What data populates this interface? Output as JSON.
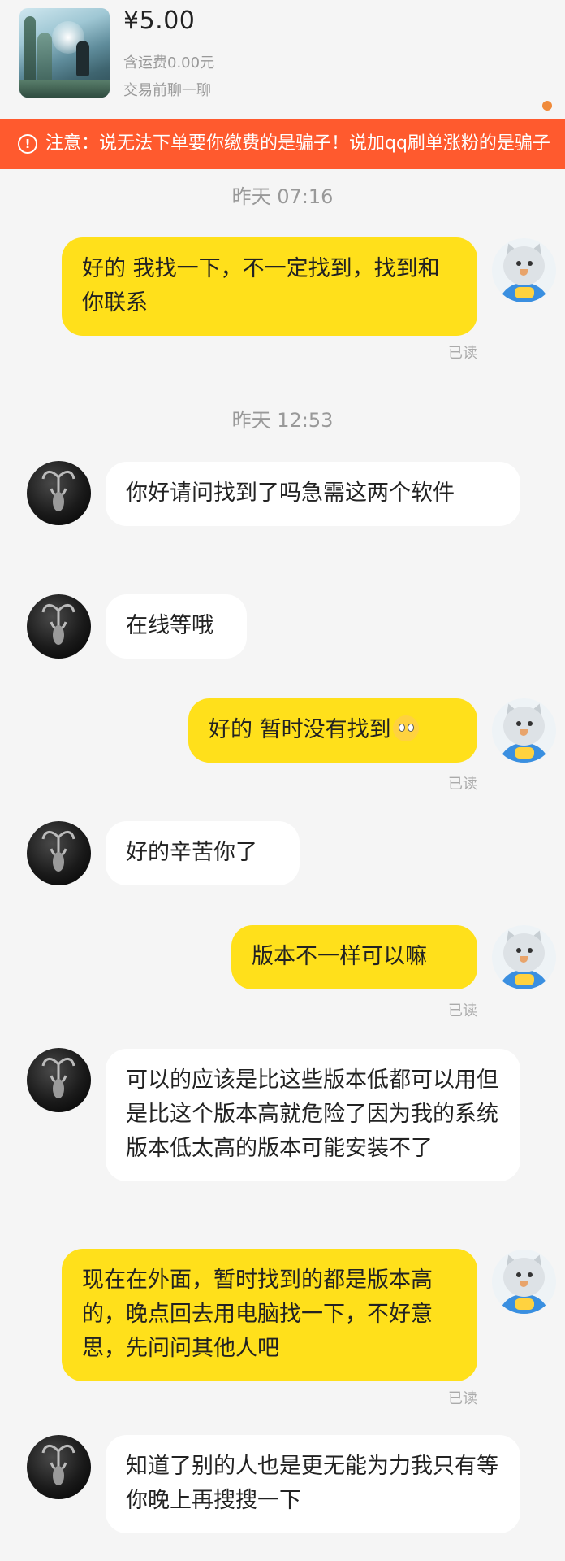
{
  "product": {
    "price": "¥5.00",
    "shipping": "含运费0.00元",
    "chat_before": "交易前聊一聊"
  },
  "banner": {
    "icon": "!",
    "text": "注意：说无法下单要你缴费的是骗子！说加qq刷单涨粉的是骗子"
  },
  "messages": {
    "ts1": "昨天 07:16",
    "m1": "好的 我找一下，不一定找到，找到和你联系",
    "read1": "已读",
    "ts2": "昨天 12:53",
    "m2": "你好请问找到了吗急需这两个软件",
    "m3": "在线等哦",
    "m4": "好的 暂时没有找到",
    "read4": "已读",
    "m5": "好的辛苦你了",
    "m6": "版本不一样可以嘛",
    "read6": "已读",
    "m7": "可以的应该是比这些版本低都可以用但是比这个版本高就危险了因为我的系统版本低太高的版本可能安装不了",
    "m8": "现在在外面，暂时找到的都是版本高的，晚点回去用电脑找一下，不好意思，先问问其他人吧",
    "read8": "已读",
    "m9": "知道了别的人也是更无能为力我只有等你晚上再搜搜一下"
  },
  "colors": {
    "my_bubble": "#ffe01b",
    "their_bubble": "#ffffff",
    "banner": "#ff5a2e",
    "background": "#f5f5f5"
  },
  "icons": {
    "warning": "warning-circle-icon",
    "emoji": "woozy-face-emoji"
  }
}
